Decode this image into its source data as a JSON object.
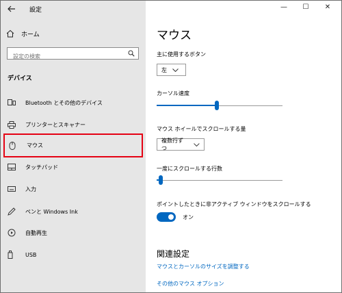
{
  "window": {
    "title": "設定"
  },
  "controls": {
    "minimize": "—",
    "maximize": "☐",
    "close": "✕"
  },
  "sidebar": {
    "home_label": "ホーム",
    "search_placeholder": "設定の検索",
    "section_title": "デバイス",
    "items": [
      {
        "label": "Bluetooth とその他のデバイス",
        "icon": "bluetooth-device-icon"
      },
      {
        "label": "プリンターとスキャナー",
        "icon": "printer-icon"
      },
      {
        "label": "マウス",
        "icon": "mouse-icon"
      },
      {
        "label": "タッチパッド",
        "icon": "touchpad-icon"
      },
      {
        "label": "入力",
        "icon": "keyboard-icon"
      },
      {
        "label": "ペンと Windows Ink",
        "icon": "pen-icon"
      },
      {
        "label": "自動再生",
        "icon": "autoplay-icon"
      },
      {
        "label": "USB",
        "icon": "usb-icon"
      }
    ],
    "active_item": "マウス"
  },
  "main": {
    "page_title": "マウス",
    "primary_button": {
      "label": "主に使用するボタン",
      "value": "左"
    },
    "cursor_speed": {
      "label": "カーソル速度",
      "level": 0.48
    },
    "wheel_scroll": {
      "label": "マウス ホイールでスクロールする量",
      "value": "複数行ずつ"
    },
    "lines_scroll": {
      "label": "一度にスクロールする行数",
      "level": 0.03
    },
    "inactive_scroll": {
      "label": "ポイントしたときに非アクティブ ウィンドウをスクロールする",
      "state": "オン"
    },
    "related": {
      "title": "関連設定",
      "links": [
        "マウスとカーソルのサイズを調整する",
        "その他のマウス オプション"
      ]
    }
  },
  "colors": {
    "accent": "#0067c0",
    "highlight_box": "#e50012",
    "sidebar_bg": "#e6e6e6"
  }
}
